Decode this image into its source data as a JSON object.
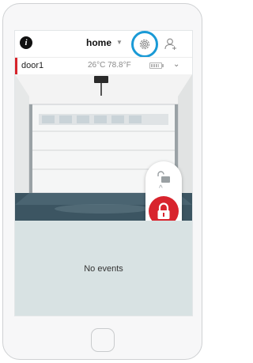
{
  "header": {
    "info_glyph": "i",
    "location_label": "home",
    "location_caret": "▼",
    "settings_icon": "gear-icon",
    "users_icon": "user-icon"
  },
  "device": {
    "name": "door1",
    "temperature": "26°C 78.8°F",
    "battery_icon": "battery-icon",
    "expand_glyph": "⌄",
    "accent_color": "#d6242b"
  },
  "camera": {
    "lock_state": "locked",
    "unlock_icon": "unlock-icon",
    "lock_icon": "lock-icon",
    "up_glyph": "^"
  },
  "events": {
    "empty_text": "No events"
  },
  "colors": {
    "highlight_ring": "#1a9ad6",
    "lock_button": "#d8242d",
    "events_bg": "#d8e2e3"
  }
}
